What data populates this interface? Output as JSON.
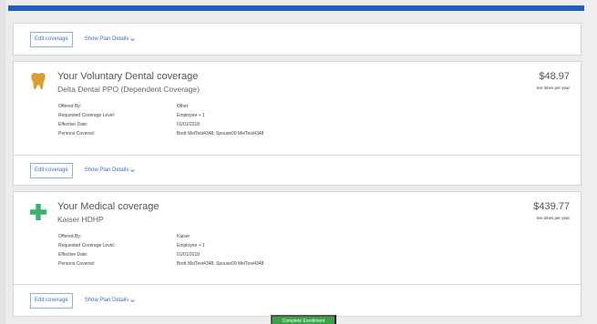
{
  "top_actions": {
    "edit_label": "Edit coverage",
    "details_label": "Show Plan Details"
  },
  "dental": {
    "title": "Your Voluntary Dental coverage",
    "plan": "Delta Dental PPO (Dependent Coverage)",
    "price": "$48.97",
    "frequency": "ten times per year",
    "details": [
      {
        "label": "Offered By:",
        "value": "Other"
      },
      {
        "label": "Requested Coverage Level:",
        "value": "Employee + 1"
      },
      {
        "label": "Effective Date:",
        "value": "01/01/2018"
      },
      {
        "label": "Persons Covered:",
        "value": "Brett MelTest4348, Spouse09 MelTest4348"
      }
    ],
    "edit_label": "Edit coverage",
    "details_label": "Show Plan Details",
    "icon_color": "#d9a12c"
  },
  "medical": {
    "title": "Your Medical coverage",
    "plan": "Kaiser HDHP",
    "price": "$439.77",
    "frequency": "ten times per year",
    "details": [
      {
        "label": "Offered By:",
        "value": "Kaiser"
      },
      {
        "label": "Requested Coverage Level:",
        "value": "Employee + 1"
      },
      {
        "label": "Effective Date:",
        "value": "01/01/2018"
      },
      {
        "label": "Persons Covered:",
        "value": "Brett MelTest4348, Spouse09 MelTest4348"
      }
    ],
    "edit_label": "Edit coverage",
    "details_label": "Show Plan Details",
    "icon_color": "#3bb36a"
  },
  "footer": {
    "complete_label": "Complete Enrollment"
  },
  "colors": {
    "header_bar": "#1f5fb8",
    "link": "#3a72c4",
    "complete_button": "#38a447"
  }
}
